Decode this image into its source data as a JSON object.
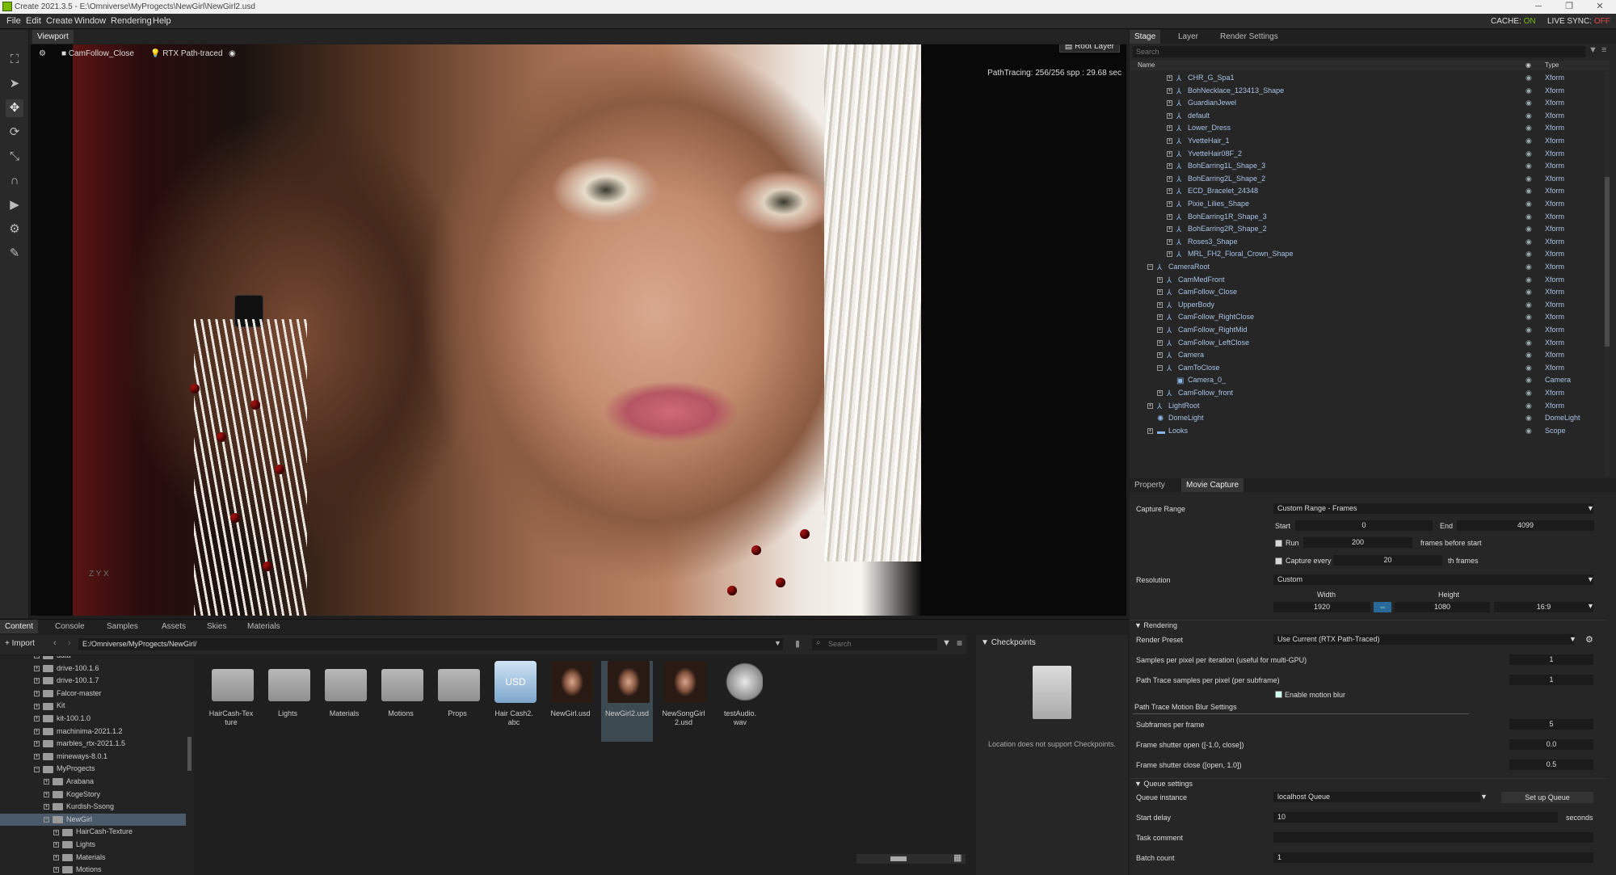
{
  "window": {
    "title": "Create 2021.3.5 - E:\\Omniverse\\MyProgects\\NewGirl\\NewGirl2.usd",
    "controls": [
      "─",
      "❐",
      "✕"
    ]
  },
  "menu": [
    "File",
    "Edit",
    "Create",
    "Window",
    "Rendering",
    "Help"
  ],
  "status": {
    "cache_label": "CACHE:",
    "cache_value": "ON",
    "livesync_label": "LIVE SYNC:",
    "livesync_value": "OFF"
  },
  "viewport": {
    "tab": "Viewport",
    "camera": "CamFollow_Close",
    "renderer": "RTX Path-traced",
    "layer": "Root Layer",
    "pt_info": "PathTracing: 256/256 spp : 29.68 sec",
    "axis": "Z  Y  X"
  },
  "tools": [
    "camera-icon",
    "select-icon",
    "move-icon",
    "rotate-icon",
    "scale-icon",
    "snap-icon",
    "play-icon",
    "physics-icon",
    "paint-icon"
  ],
  "stage": {
    "tabs": [
      "Stage",
      "Layer",
      "Render Settings"
    ],
    "search_placeholder": "Search",
    "col_name": "Name",
    "col_type": "Type",
    "rows": [
      {
        "name": "CHR_G_Spa1",
        "type": "Xform",
        "indent": 2
      },
      {
        "name": "BohNecklace_123413_Shape",
        "type": "Xform",
        "indent": 2
      },
      {
        "name": "GuardianJewel",
        "type": "Xform",
        "indent": 2
      },
      {
        "name": "default",
        "type": "Xform",
        "indent": 2
      },
      {
        "name": "Lower_Dress",
        "type": "Xform",
        "indent": 2
      },
      {
        "name": "YvetteHair_1",
        "type": "Xform",
        "indent": 2
      },
      {
        "name": "YvetteHair08F_2",
        "type": "Xform",
        "indent": 2
      },
      {
        "name": "BohEarring1L_Shape_3",
        "type": "Xform",
        "indent": 2
      },
      {
        "name": "BohEarring2L_Shape_2",
        "type": "Xform",
        "indent": 2
      },
      {
        "name": "ECD_Bracelet_24348",
        "type": "Xform",
        "indent": 2
      },
      {
        "name": "Pixie_Lilies_Shape",
        "type": "Xform",
        "indent": 2
      },
      {
        "name": "BohEarring1R_Shape_3",
        "type": "Xform",
        "indent": 2
      },
      {
        "name": "BohEarring2R_Shape_2",
        "type": "Xform",
        "indent": 2
      },
      {
        "name": "Roses3_Shape",
        "type": "Xform",
        "indent": 2
      },
      {
        "name": "MRL_FH2_Floral_Crown_Shape",
        "type": "Xform",
        "indent": 2
      },
      {
        "name": "CameraRoot",
        "type": "Xform",
        "indent": 0,
        "open": true
      },
      {
        "name": "CamMedFront",
        "type": "Xform",
        "indent": 1
      },
      {
        "name": "CamFollow_Close",
        "type": "Xform",
        "indent": 1
      },
      {
        "name": "UpperBody",
        "type": "Xform",
        "indent": 1
      },
      {
        "name": "CamFollow_RightClose",
        "type": "Xform",
        "indent": 1
      },
      {
        "name": "CamFollow_RightMid",
        "type": "Xform",
        "indent": 1
      },
      {
        "name": "CamFollow_LeftClose",
        "type": "Xform",
        "indent": 1
      },
      {
        "name": "Camera",
        "type": "Xform",
        "indent": 1
      },
      {
        "name": "CamToClose",
        "type": "Xform",
        "indent": 1,
        "open": true
      },
      {
        "name": "Camera_0_",
        "type": "Camera",
        "indent": 2,
        "leaf": true
      },
      {
        "name": "CamFollow_front",
        "type": "Xform",
        "indent": 1
      },
      {
        "name": "LightRoot",
        "type": "Xform",
        "indent": 0
      },
      {
        "name": "DomeLight",
        "type": "DomeLight",
        "indent": 0,
        "leaf": true
      },
      {
        "name": "Looks",
        "type": "Scope",
        "indent": 0
      }
    ]
  },
  "props": {
    "tabs": [
      "Property",
      "Movie Capture"
    ],
    "capture_range_label": "Capture Range",
    "capture_range_value": "Custom Range - Frames",
    "start_label": "Start",
    "start_value": "0",
    "end_label": "End",
    "end_value": "4099",
    "run_label": "Run",
    "run_value": "200",
    "run_suffix": "frames before start",
    "capture_every_label": "Capture every",
    "capture_every_value": "20",
    "capture_every_suffix": "th frames",
    "resolution_label": "Resolution",
    "resolution_value": "Custom",
    "width_label": "Width",
    "width_value": "1920",
    "height_label": "Height",
    "height_value": "1080",
    "aspect_value": "16:9",
    "rendering_label": "Rendering",
    "render_preset_label": "Render Preset",
    "render_preset_value": "Use Current (RTX Path-Traced)",
    "spp_iter_label": "Samples per pixel per iteration (useful for multi-GPU)",
    "spp_iter_value": "1",
    "pt_spp_label": "Path Trace samples per pixel (per subframe)",
    "pt_spp_value": "1",
    "motion_blur_label": "Enable motion blur",
    "pt_mb_label": "Path Trace Motion Blur Settings",
    "subframes_label": "Subframes per frame",
    "subframes_value": "5",
    "shutter_open_label": "Frame shutter open ([-1.0, close])",
    "shutter_open_value": "0.0",
    "shutter_close_label": "Frame shutter close ([open, 1.0])",
    "shutter_close_value": "0.5",
    "queue_settings_label": "Queue settings",
    "queue_instance_label": "Queue instance",
    "queue_instance_value": "localhost Queue",
    "setup_queue_label": "Set up Queue",
    "start_delay_label": "Start delay",
    "start_delay_value": "10",
    "start_delay_unit": "seconds",
    "task_comment_label": "Task comment",
    "task_comment_value": "",
    "batch_count_label": "Batch count",
    "batch_count_value": "1"
  },
  "content": {
    "tabs": [
      "Content",
      "Console",
      "Samples",
      "Assets",
      "Skies",
      "Materials"
    ],
    "import_label": "Import",
    "path": "E:/Omniverse/MyProgects/NewGirl/",
    "search_placeholder": "Search",
    "tree": [
      {
        "name": "data",
        "indent": 1
      },
      {
        "name": "drive-100.1.6",
        "indent": 1
      },
      {
        "name": "drive-100.1.7",
        "indent": 1
      },
      {
        "name": "Falcor-master",
        "indent": 1
      },
      {
        "name": "Kit",
        "indent": 1
      },
      {
        "name": "kit-100.1.0",
        "indent": 1
      },
      {
        "name": "machinima-2021.1.2",
        "indent": 1
      },
      {
        "name": "marbles_rtx-2021.1.5",
        "indent": 1
      },
      {
        "name": "mineways-8.0.1",
        "indent": 1
      },
      {
        "name": "MyProgects",
        "indent": 1,
        "open": true
      },
      {
        "name": "Arabana",
        "indent": 2
      },
      {
        "name": "KogeStory",
        "indent": 2
      },
      {
        "name": "Kurdish-Ssong",
        "indent": 2
      },
      {
        "name": "NewGirl",
        "indent": 2,
        "open": true,
        "selected": true
      },
      {
        "name": "HairCash-Texture",
        "indent": 3
      },
      {
        "name": "Lights",
        "indent": 3
      },
      {
        "name": "Materials",
        "indent": 3
      },
      {
        "name": "Motions",
        "indent": 3
      }
    ],
    "items": [
      {
        "label": "HairCash-Tex\nture",
        "kind": "folder"
      },
      {
        "label": "Lights",
        "kind": "folder"
      },
      {
        "label": "Materials",
        "kind": "folder"
      },
      {
        "label": "Motions",
        "kind": "folder"
      },
      {
        "label": "Props",
        "kind": "folder"
      },
      {
        "label": "Hair Cash2.\nabc",
        "kind": "usd"
      },
      {
        "label": "NewGirl.usd",
        "kind": "portrait"
      },
      {
        "label": "NewGirl2.usd",
        "kind": "portrait",
        "selected": true
      },
      {
        "label": "NewSongGirl\n2.usd",
        "kind": "portrait"
      },
      {
        "label": "testAudio.\nwav",
        "kind": "audio"
      }
    ],
    "checkpoints_title": "Checkpoints",
    "checkpoints_msg": "Location does not support Checkpoints."
  },
  "colors": {
    "accent": "#76b900",
    "selection": "#4a5a6a",
    "tree_text": "#a9c3e6",
    "off": "#e14b4b"
  }
}
